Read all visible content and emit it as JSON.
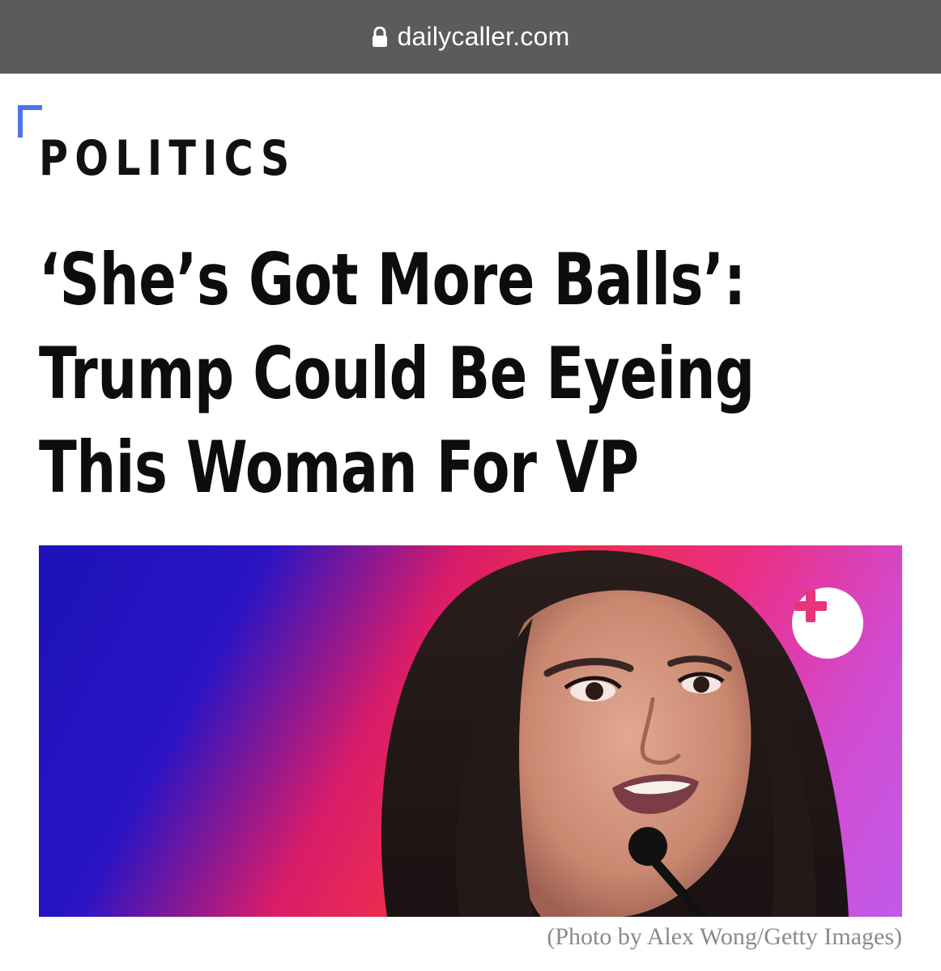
{
  "browser": {
    "url": "dailycaller.com",
    "lock_icon": "lock-icon",
    "bar_color": "#5b5b5b"
  },
  "article": {
    "category": "POLITICS",
    "headline": "‘She’s Got More Balls’: Trump Could Be Eyeing This Woman For VP",
    "accent_color": "#4d74e8",
    "image": {
      "expand_icon": "plus-icon",
      "expand_icon_color": "#e8347c"
    },
    "caption": "(Photo by Alex Wong/Getty Images)"
  }
}
